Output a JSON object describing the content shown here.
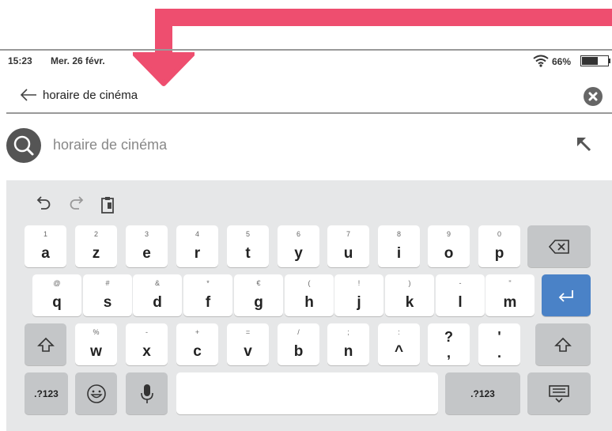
{
  "status_bar": {
    "time": "15:23",
    "date": "Mer. 26 févr.",
    "battery_text": "66%",
    "battery_level": 0.66
  },
  "search_bar": {
    "query": "horaire de cinéma"
  },
  "suggestion": {
    "text": "horaire de cinéma"
  },
  "keyboard": {
    "row1": [
      {
        "hint": "1",
        "main": "a"
      },
      {
        "hint": "2",
        "main": "z"
      },
      {
        "hint": "3",
        "main": "e"
      },
      {
        "hint": "4",
        "main": "r"
      },
      {
        "hint": "5",
        "main": "t"
      },
      {
        "hint": "6",
        "main": "y"
      },
      {
        "hint": "7",
        "main": "u"
      },
      {
        "hint": "8",
        "main": "i"
      },
      {
        "hint": "9",
        "main": "o"
      },
      {
        "hint": "0",
        "main": "p"
      }
    ],
    "row2": [
      {
        "hint": "@",
        "main": "q"
      },
      {
        "hint": "#",
        "main": "s"
      },
      {
        "hint": "&",
        "main": "d"
      },
      {
        "hint": "*",
        "main": "f"
      },
      {
        "hint": "€",
        "main": "g"
      },
      {
        "hint": "(",
        "main": "h"
      },
      {
        "hint": "!",
        "main": "j"
      },
      {
        "hint": ")",
        "main": "k"
      },
      {
        "hint": "-",
        "main": "l"
      },
      {
        "hint": "\"",
        "main": "m"
      }
    ],
    "row3": [
      {
        "hint": "%",
        "main": "w"
      },
      {
        "hint": "-",
        "main": "x"
      },
      {
        "hint": "+",
        "main": "c"
      },
      {
        "hint": "=",
        "main": "v"
      },
      {
        "hint": "/",
        "main": "b"
      },
      {
        "hint": ";",
        "main": "n"
      },
      {
        "hint": ":",
        "main": "^"
      }
    ],
    "row3_punct": [
      {
        "top": "?",
        "bottom": ","
      },
      {
        "top": "'",
        "bottom": "."
      }
    ],
    "symbols_label_left": ".?123",
    "symbols_label_right": ".?123"
  },
  "colors": {
    "annotation": "#ee4e6f",
    "enter_key": "#4a82c7",
    "keyboard_bg": "#e6e7e8"
  },
  "icons": [
    "back-arrow-icon",
    "clear-icon",
    "search-icon",
    "fill-query-arrow-icon",
    "undo-icon",
    "redo-icon",
    "clipboard-icon",
    "backspace-icon",
    "enter-icon",
    "shift-icon",
    "emoji-icon",
    "microphone-icon",
    "hide-keyboard-icon",
    "wifi-icon",
    "battery-icon"
  ]
}
